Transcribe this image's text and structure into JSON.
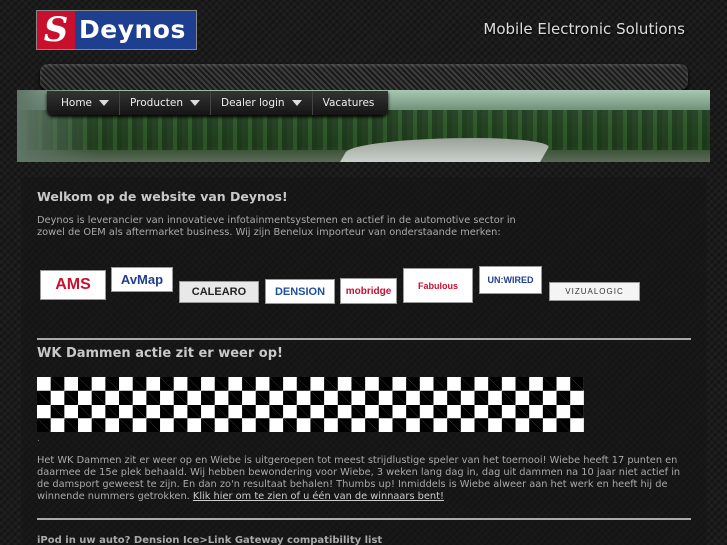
{
  "header": {
    "logo_letter": "S",
    "logo_text": "Deynos",
    "tagline": "Mobile Electronic Solutions"
  },
  "nav": {
    "items": [
      {
        "label": "Home",
        "has_dropdown": true
      },
      {
        "label": "Producten",
        "has_dropdown": true
      },
      {
        "label": "Dealer login",
        "has_dropdown": true
      },
      {
        "label": "Vacatures",
        "has_dropdown": false
      }
    ]
  },
  "welcome": {
    "title": "Welkom op de website van Deynos!",
    "intro": "Deynos is leverancier van innovatieve infotainmentsystemen en actief in de automotive sector in zowel de OEM als aftermarket business. Wij zijn Benelux importeur van onderstaande merken:"
  },
  "brands": [
    {
      "name": "AMS",
      "color": "#c8102e"
    },
    {
      "name": "AvMap",
      "color": "#1e3f8f"
    },
    {
      "name": "CALEARO",
      "color": "#222222"
    },
    {
      "name": "DENSION",
      "color": "#1e4f9f"
    },
    {
      "name": "mobridge",
      "color": "#c8102e"
    },
    {
      "name": "Fabulous",
      "color": "#c8102e"
    },
    {
      "name": "UN:WIRED",
      "color": "#1e3f8f"
    },
    {
      "name": "VIZUALOGIC",
      "color": "#333333"
    }
  ],
  "news": [
    {
      "title": "WK Dammen actie zit er weer op!",
      "dot": ".",
      "body": "Het WK Dammen zit er weer op en Wiebe is uitgeroepen tot meest strijdlustige speler van het toernooi! Wiebe heeft 17 punten en daarmee de 15e plek behaald. Wij hebben bewondering voor Wiebe, 3 weken lang dag in, dag uit dammen na 10 jaar niet actief in de damsport geweest te zijn. En dan zo'n resultaat behalen! Thumbs up! Inmiddels is Wiebe alweer aan het werk en heeft hij de winnende nummers getrokken.",
      "link": "Klik hier om te zien of u één van de winnaars bent!"
    },
    {
      "title": "iPod in uw auto? Dension Ice>Link Gateway compatibility list"
    }
  ]
}
